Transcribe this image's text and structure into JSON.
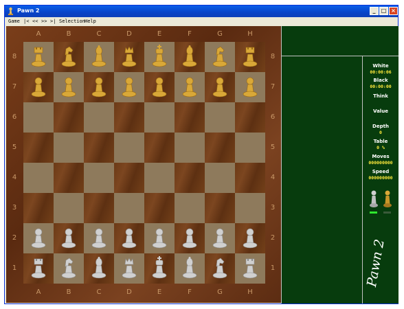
{
  "window": {
    "title": "Pawn 2",
    "minimize": "_",
    "maximize": "□",
    "close": "×"
  },
  "menu": {
    "game": "Game",
    "first": "|<",
    "prev": "<<",
    "next": ">>",
    "last": ">|",
    "selection": "Selection",
    "help": "Help"
  },
  "board": {
    "files": [
      "A",
      "B",
      "C",
      "D",
      "E",
      "F",
      "G",
      "H"
    ],
    "ranks": [
      "8",
      "7",
      "6",
      "5",
      "4",
      "3",
      "2",
      "1"
    ],
    "position": [
      [
        "r",
        "n",
        "b",
        "q",
        "k",
        "b",
        "n",
        "r"
      ],
      [
        "p",
        "p",
        "p",
        "p",
        "p",
        "p",
        "p",
        "p"
      ],
      [
        "",
        "",
        "",
        "",
        "",
        "",
        "",
        ""
      ],
      [
        "",
        "",
        "",
        "",
        "",
        "",
        "",
        ""
      ],
      [
        "",
        "",
        "",
        "",
        "",
        "",
        "",
        ""
      ],
      [
        "",
        "",
        "",
        "",
        "",
        "",
        "",
        ""
      ],
      [
        "P",
        "P",
        "P",
        "P",
        "P",
        "P",
        "P",
        "P"
      ],
      [
        "R",
        "N",
        "B",
        "Q",
        "K",
        "B",
        "N",
        "R"
      ]
    ],
    "colors": {
      "gold": "#d9a838",
      "silver": "#d0d0d0"
    }
  },
  "info": {
    "white_label": "White",
    "white_time": "00:00:06",
    "black_label": "Black",
    "black_time": "00:00:00",
    "think_label": "Think",
    "value_label": "Value",
    "depth_label": "Depth",
    "depth_value": "0",
    "table_label": "Table",
    "table_value": "0 %",
    "moves_label": "Moves",
    "moves_value": "000000000",
    "speed_label": "Speed",
    "speed_value": "000000000",
    "brand": "Pawn 2"
  }
}
